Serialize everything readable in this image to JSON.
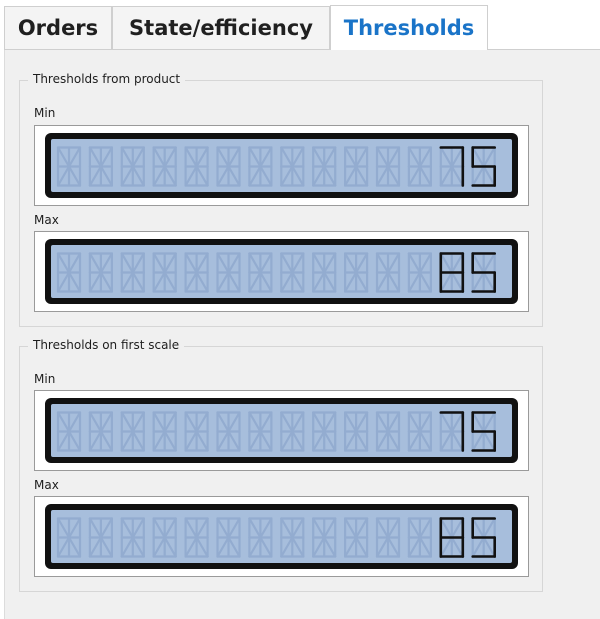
{
  "tabs": [
    {
      "label": "Orders",
      "active": false
    },
    {
      "label": "State/efficiency",
      "active": false
    },
    {
      "label": "Thresholds",
      "active": true
    }
  ],
  "groups": [
    {
      "title": "Thresholds from product",
      "min_label": "Min",
      "min_value": "75",
      "max_label": "Max",
      "max_value": "85"
    },
    {
      "title": "Thresholds on first scale",
      "min_label": "Min",
      "min_value": "75",
      "max_label": "Max",
      "max_value": "85"
    }
  ],
  "colors": {
    "active_tab_text": "#1a74c8",
    "lcd_background": "#a7bedc",
    "lcd_segment_on": "#111111",
    "lcd_segment_off": "#93acd0"
  }
}
